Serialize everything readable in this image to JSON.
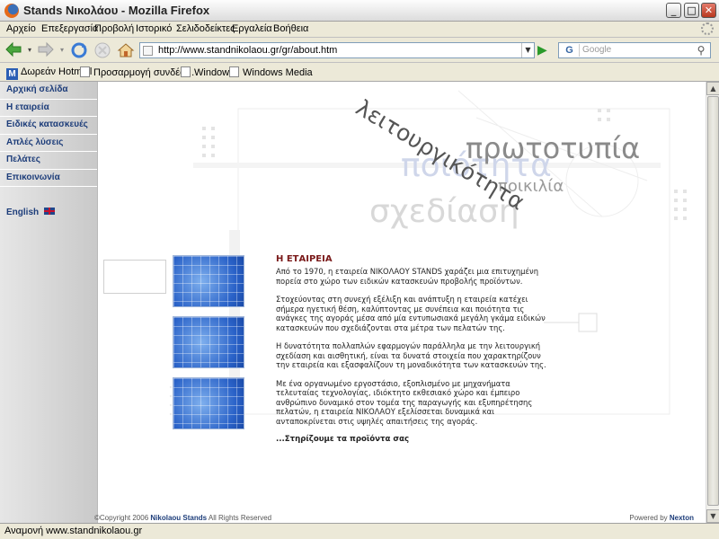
{
  "window": {
    "title": "Stands Νικολάου - Mozilla Firefox",
    "minimize_glyph": "_",
    "maximize_glyph": "□",
    "close_glyph": "✕"
  },
  "menu": {
    "items": [
      "Αρχείο",
      "Επεξεργασία",
      "Προβολή",
      "Ιστορικό",
      "Σελιδοδείκτες",
      "Εργαλεία",
      "Βοήθεια"
    ]
  },
  "navigation": {
    "url": "http://www.standnikolaou.gr/gr/about.htm",
    "search_placeholder": "Google",
    "search_engine_glyph": "G"
  },
  "bookmarks": {
    "items": [
      "Δωρεάν Hotmail",
      "Προσαρμογή συνδέσ...",
      "Windows",
      "Windows Media"
    ]
  },
  "site": {
    "nav_items": [
      "Αρχική σελίδα",
      "Η εταιρεία",
      "Ειδικές κατασκευές",
      "Απλές λύσεις",
      "Πελάτες",
      "Επικοινωνία"
    ],
    "language_link": "English",
    "header_words": {
      "functionality": "λειτουργικότητα",
      "prototype": "πρωτοτυπία",
      "quality": "ποιότητα",
      "variety": "ποικιλία",
      "design": "σχεδίαση"
    },
    "article": {
      "heading": "Η ΕΤΑΙΡΕΙΑ",
      "paragraphs": [
        "Από το 1970, η εταιρεία ΝΙΚΟΛΑΟΥ STANDS χαράζει μια επιτυχημένη πορεία στο χώρο των ειδικών κατασκευών προβολής προϊόντων.",
        "Στοχεύοντας στη συνεχή εξέλιξη και ανάπτυξη η εταιρεία κατέχει σήμερα ηγετική θέση, καλύπτοντας με συνέπεια και ποιότητα τις ανάγκες της αγοράς μέσα από μία εντυπωσιακά μεγάλη γκάμα ειδικών κατασκευών που σχεδιάζονται στα μέτρα των πελατών της.",
        "Η δυνατότητα πολλαπλών εφαρμογών παράλληλα με την λειτουργική σχεδίαση και αισθητική, είναι τα δυνατά στοιχεία που χαρακτηρίζουν την εταιρεία και εξασφαλίζουν τη μοναδικότητα των κατασκευών της.",
        "Με ένα οργανωμένο εργοστάσιο, εξοπλισμένο με μηχανήματα τελευταίας τεχνολογίας, ιδιόκτητο εκθεσιακό χώρο και έμπειρο ανθρώπινο δυναμικό στον τομέα της παραγωγής και εξυπηρέτησης πελατών, η εταιρεία ΝΙΚΟΛΑΟΥ εξελίσσεται δυναμικά και ανταποκρίνεται στις υψηλές απαιτήσεις της αγοράς."
      ],
      "slogan": "...Στηρίζουμε τα προϊόντα σας"
    },
    "footer": {
      "copyright_prefix": "©Copyright 2006",
      "copyright_link": "Nikolaou Stands",
      "copyright_suffix": "All Rights Reserved",
      "powered_prefix": "Powered by",
      "powered_link": "Nexton"
    }
  },
  "status": {
    "text": "Αναμονή www.standnikolaou.gr"
  },
  "colors": {
    "nav_text": "#1d3d7a",
    "heading": "#7a1a1a",
    "accent_blue": "#2a62c8"
  }
}
